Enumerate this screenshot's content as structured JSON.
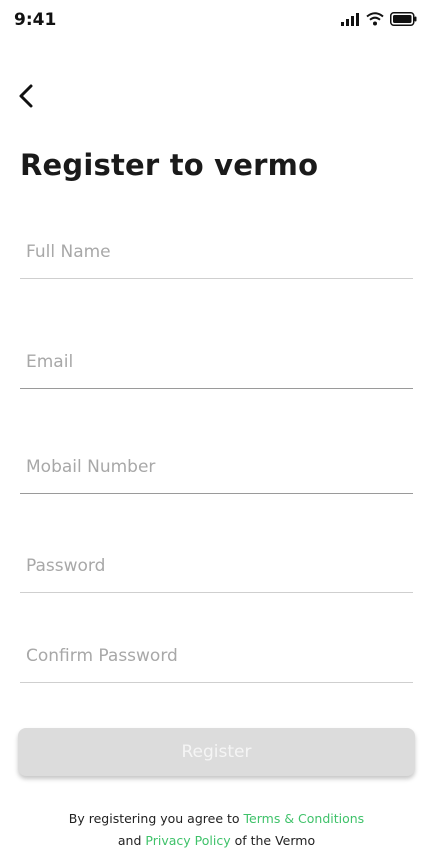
{
  "status_bar": {
    "time": "9:41",
    "icons": [
      "signal-icon",
      "wifi-icon",
      "battery-icon"
    ]
  },
  "header": {
    "back_icon": "chevron-left-icon",
    "title": "Register to vermo"
  },
  "form": {
    "full_name": {
      "placeholder": "Full Name",
      "value": ""
    },
    "email": {
      "placeholder": "Email",
      "value": ""
    },
    "mobile": {
      "placeholder": "Mobail Number",
      "value": ""
    },
    "password": {
      "placeholder": "Password",
      "value": ""
    },
    "confirm_password": {
      "placeholder": "Confirm Password",
      "value": ""
    }
  },
  "register_button": {
    "label": "Register"
  },
  "terms": {
    "prefix": "By registering you agree to",
    "terms_link": "Terms & Conditions",
    "and": "and",
    "privacy_link": "Privacy Policy",
    "suffix": "of the Vermo"
  },
  "colors": {
    "accent_link": "#3fc26a",
    "button_disabled": "#dcdcdc",
    "title": "#1a1a1a"
  }
}
